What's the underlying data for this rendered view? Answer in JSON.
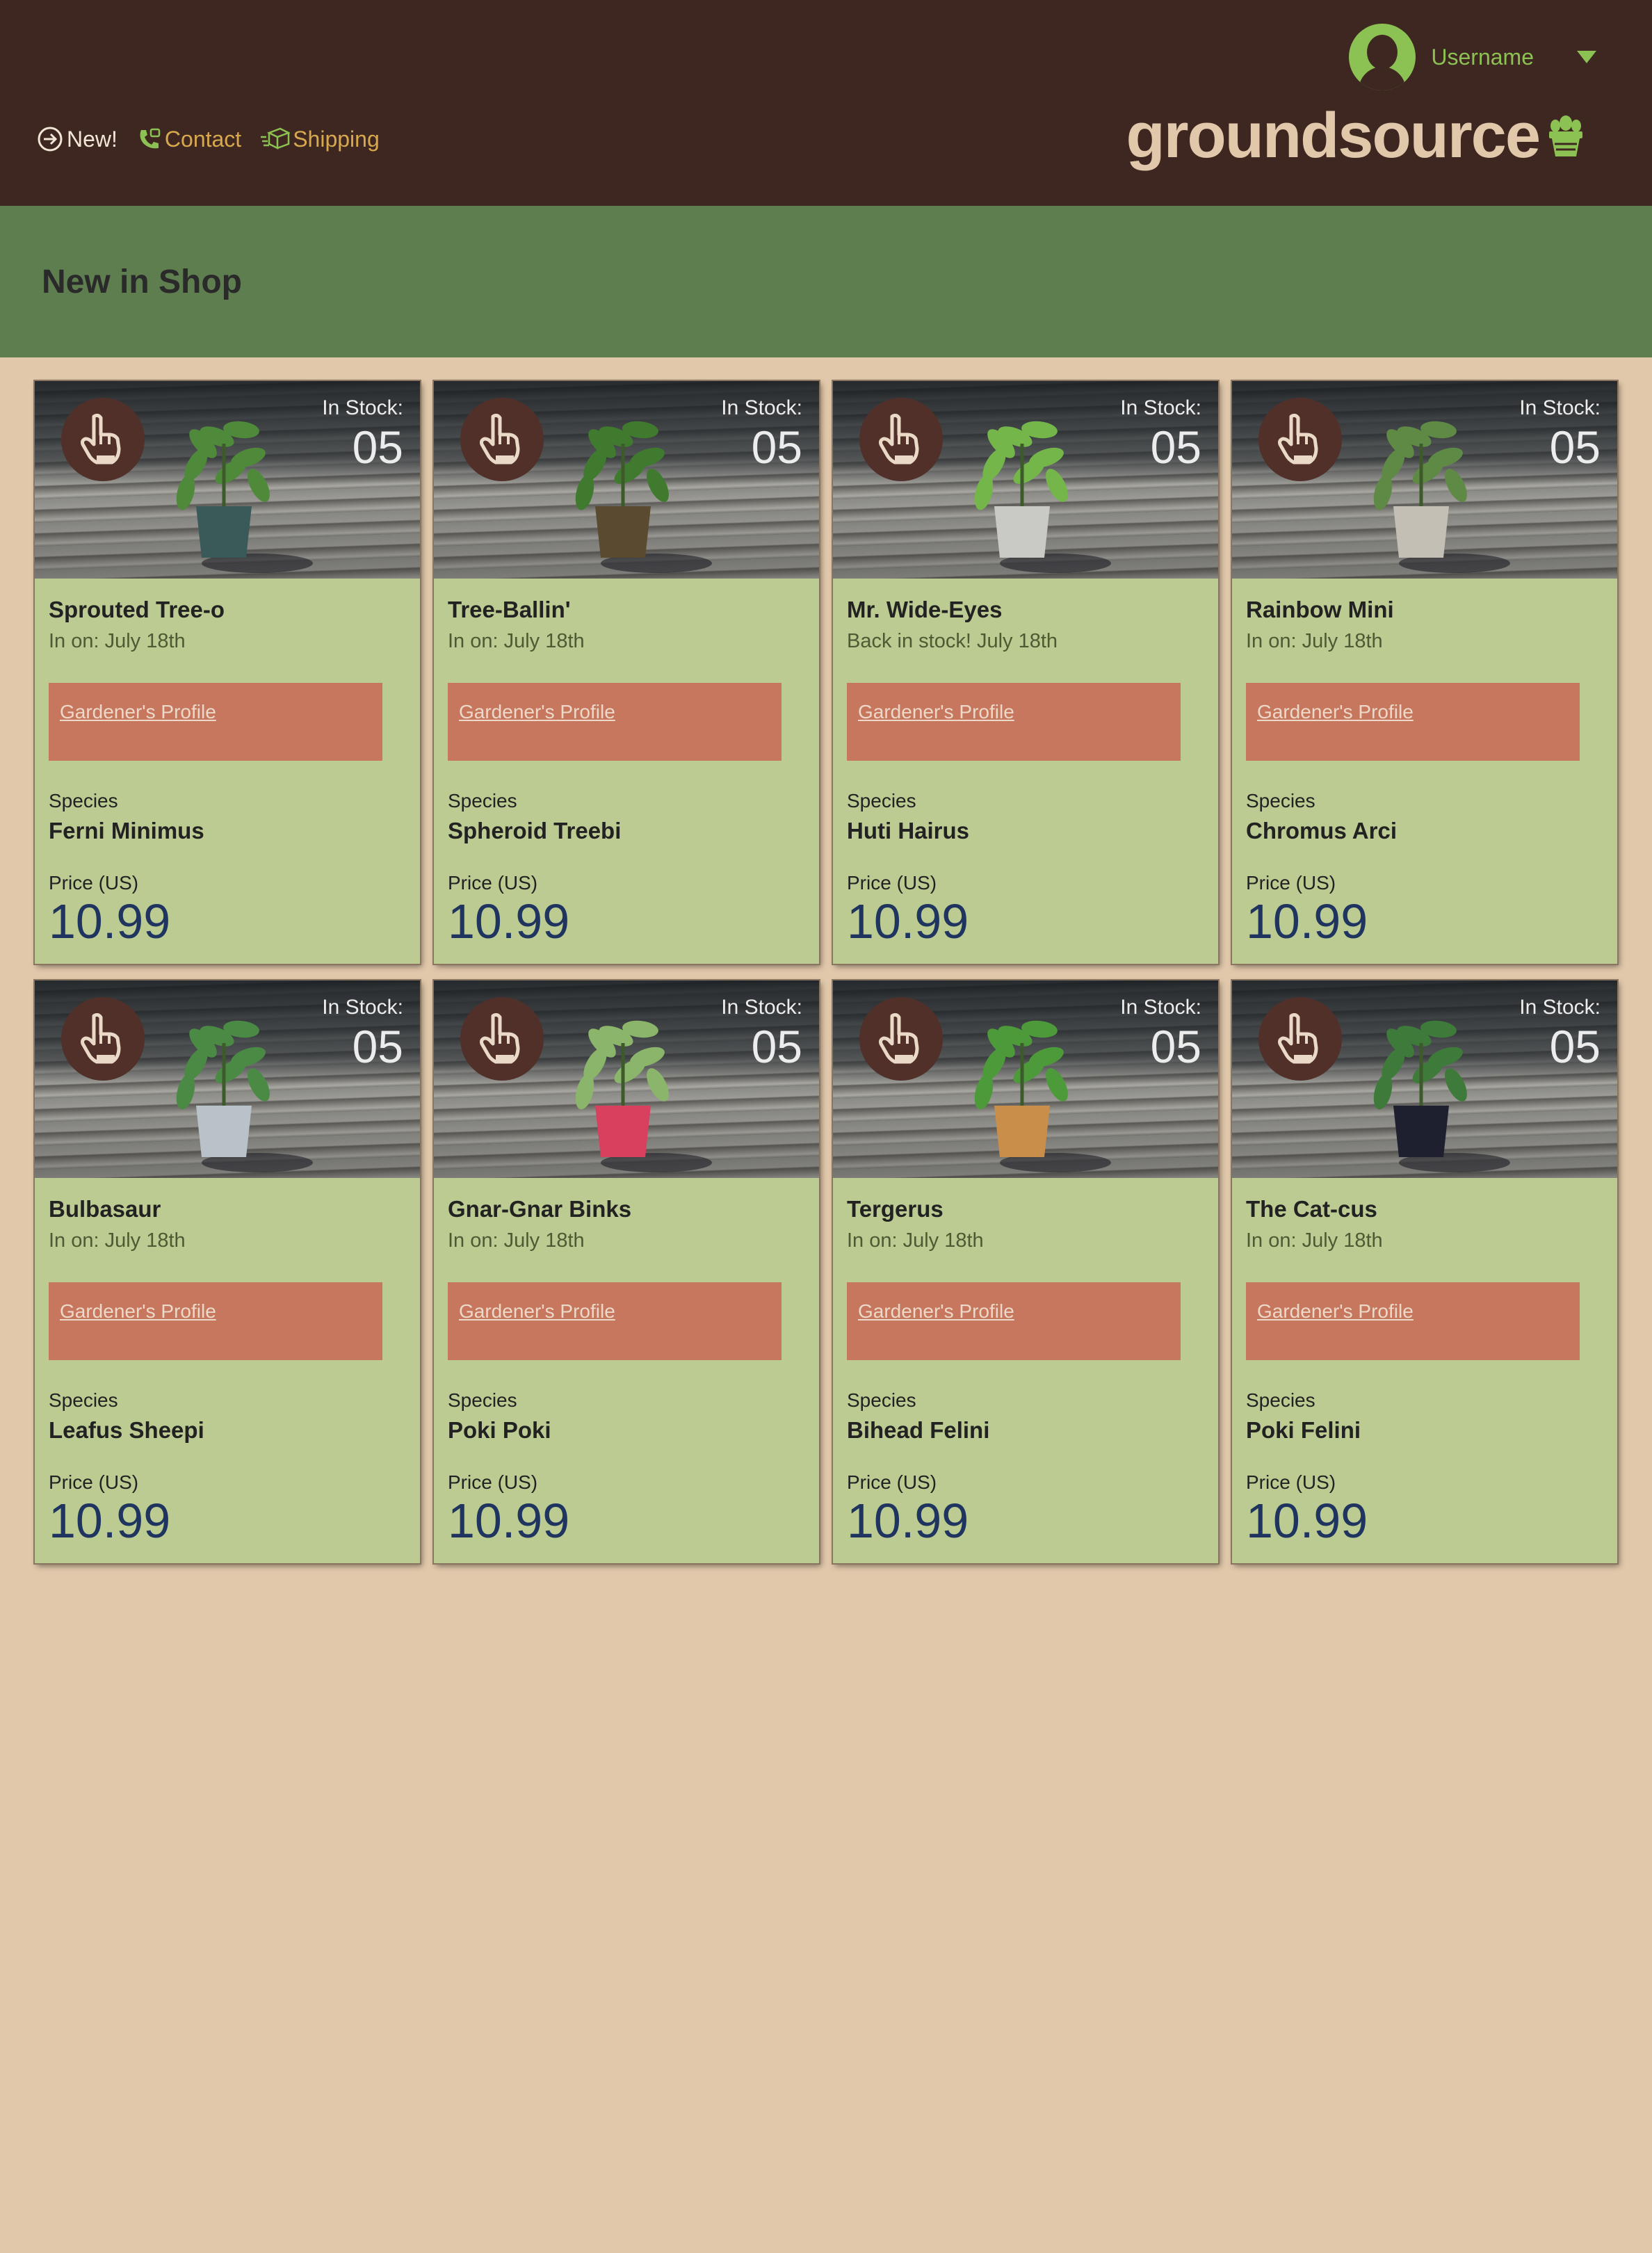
{
  "header": {
    "username": "Username",
    "brand": "groundsource",
    "nav": [
      {
        "label": "New!",
        "icon": "arrow-circle-icon"
      },
      {
        "label": "Contact",
        "icon": "phone-icon"
      },
      {
        "label": "Shipping",
        "icon": "package-icon"
      }
    ]
  },
  "section": {
    "title": "New in Shop"
  },
  "labels": {
    "in_stock": "In Stock:",
    "profile_link": "Gardener's Profile",
    "species": "Species",
    "price": "Price (US)"
  },
  "colors": {
    "header_bg": "#3d2720",
    "accent_green": "#8cc153",
    "band_green": "#5e7e4f",
    "card_bg": "#bccb91",
    "profile_bg": "#c6775d",
    "price_blue": "#1f3560",
    "page_bg": "#e1c8aa"
  },
  "products": [
    {
      "name": "Sprouted Tree-o",
      "date": "In on: July 18th",
      "stock": "05",
      "species": "Ferni Minimus",
      "price": "10.99",
      "pot": "#3a5a5a",
      "leaf": "#4f8a3a"
    },
    {
      "name": "Tree-Ballin'",
      "date": "In on: July 18th",
      "stock": "05",
      "species": "Spheroid Treebi",
      "price": "10.99",
      "pot": "#5a4a30",
      "leaf": "#3f7a2f"
    },
    {
      "name": "Mr. Wide-Eyes",
      "date": "Back in stock! July 18th",
      "stock": "05",
      "species": "Huti Hairus",
      "price": "10.99",
      "pot": "#c9c9c6",
      "leaf": "#74b64a"
    },
    {
      "name": "Rainbow Mini",
      "date": "In on: July 18th",
      "stock": "05",
      "species": "Chromus Arci",
      "price": "10.99",
      "pot": "#c4bfb5",
      "leaf": "#5f8a45"
    },
    {
      "name": "Bulbasaur",
      "date": "In on: July 18th",
      "stock": "05",
      "species": "Leafus Sheepi",
      "price": "10.99",
      "pot": "#b8c2c8",
      "leaf": "#4b8a44"
    },
    {
      "name": "Gnar-Gnar Binks",
      "date": "In on: July 18th",
      "stock": "05",
      "species": "Poki Poki",
      "price": "10.99",
      "pot": "#d9405e",
      "leaf": "#8ab56a"
    },
    {
      "name": "Tergerus",
      "date": "In on: July 18th",
      "stock": "05",
      "species": "Bihead Felini",
      "price": "10.99",
      "pot": "#c98f4a",
      "leaf": "#4c9a3a"
    },
    {
      "name": "The Cat-cus",
      "date": "In on: July 18th",
      "stock": "05",
      "species": "Poki Felini",
      "price": "10.99",
      "pot": "#1e2030",
      "leaf": "#3e7a3a"
    }
  ]
}
